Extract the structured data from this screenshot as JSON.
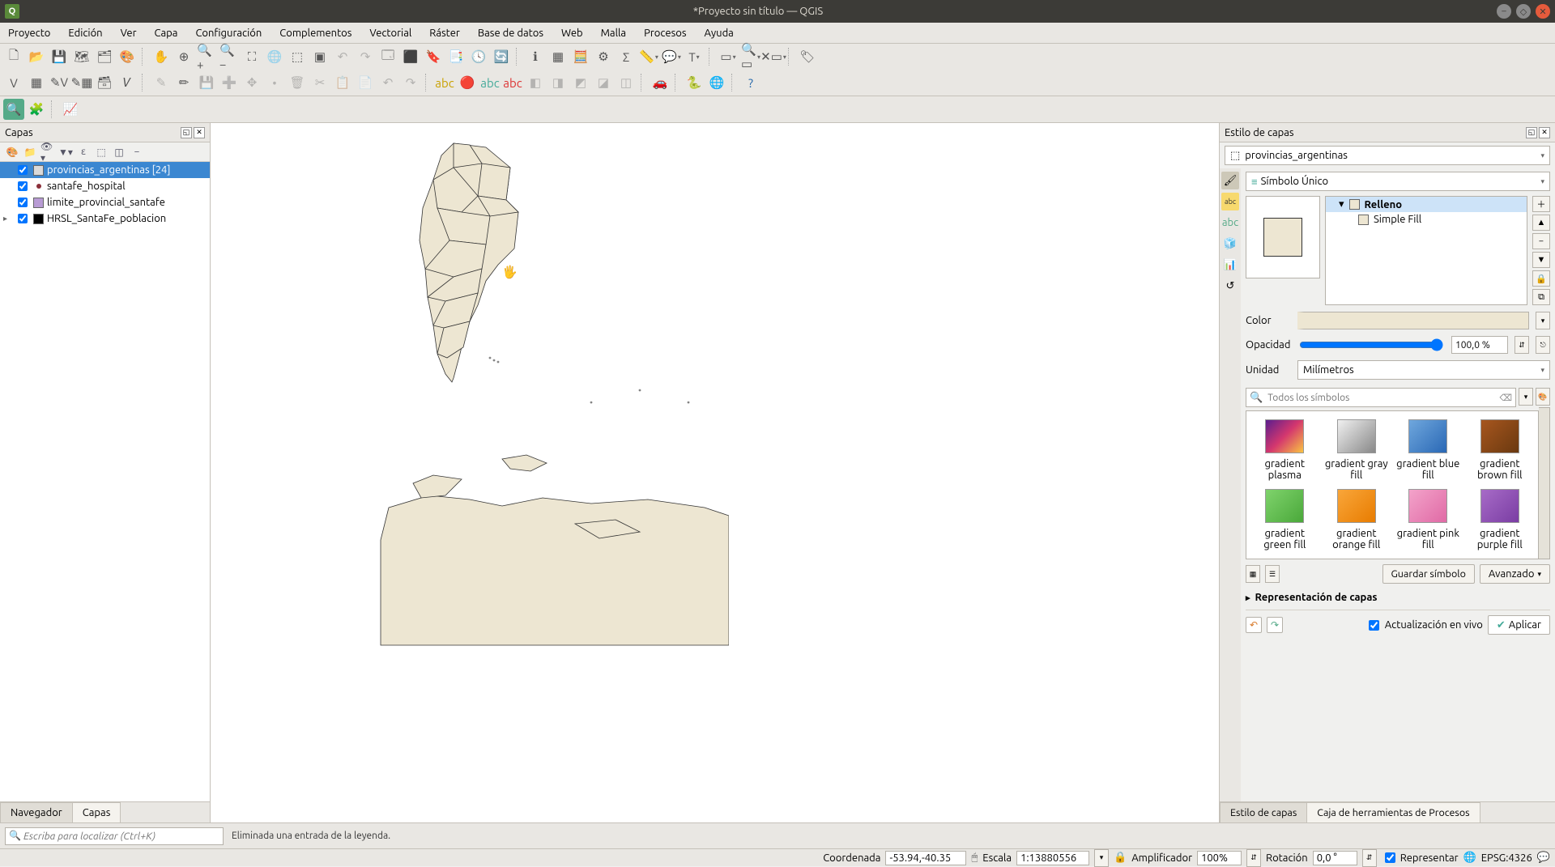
{
  "window": {
    "title": "*Proyecto sin título — QGIS"
  },
  "menubar": [
    "Proyecto",
    "Edición",
    "Ver",
    "Capa",
    "Configuración",
    "Complementos",
    "Vectorial",
    "Ráster",
    "Base de datos",
    "Web",
    "Malla",
    "Procesos",
    "Ayuda"
  ],
  "left_panel": {
    "title": "Capas",
    "layers": [
      {
        "name": "provincias_argentinas [24]",
        "checked": true,
        "selected": true,
        "swatch": "#d9d9d9"
      },
      {
        "name": "santafe_hospital",
        "checked": true,
        "selected": false,
        "swatch": "#8b2f3a",
        "dot": true
      },
      {
        "name": "limite_provincial_santafe",
        "checked": true,
        "selected": false,
        "swatch": "#b89bd4"
      },
      {
        "name": "HRSL_SantaFe_poblacion",
        "checked": true,
        "selected": false,
        "swatch": "#000",
        "expand": true
      }
    ],
    "tabs": {
      "navegador": "Navegador",
      "capas": "Capas"
    }
  },
  "right_panel": {
    "title": "Estilo de capas",
    "layer_combo": "provincias_argentinas",
    "symbol_type": "Símbolo Único",
    "tree": {
      "fill": "Relleno",
      "simple": "Simple Fill"
    },
    "props": {
      "color_label": "Color",
      "opacity_label": "Opacidad",
      "opacity_value": "100,0 %",
      "unit_label": "Unidad",
      "unit_value": "Milímetros"
    },
    "search_placeholder": "Todos los símbolos",
    "symbols": [
      {
        "name": "gradient plasma",
        "bg": "linear-gradient(135deg,#5b1e8e,#d4376e,#f9c441)"
      },
      {
        "name": "gradient gray fill",
        "bg": "linear-gradient(135deg,#f0f0f0,#888)"
      },
      {
        "name": "gradient blue fill",
        "bg": "linear-gradient(135deg,#6fa7dd,#2a68b5)"
      },
      {
        "name": "gradient brown fill",
        "bg": "linear-gradient(135deg,#a7561e,#6a3910)"
      },
      {
        "name": "gradient green fill",
        "bg": "linear-gradient(135deg,#7fd36c,#4aa83a)"
      },
      {
        "name": "gradient orange fill",
        "bg": "linear-gradient(135deg,#f9a63a,#e87c00)"
      },
      {
        "name": "gradient pink fill",
        "bg": "linear-gradient(135deg,#f3a3ca,#e06aa5)"
      },
      {
        "name": "gradient purple fill",
        "bg": "linear-gradient(135deg,#a76bc7,#7a3da3)"
      }
    ],
    "save_symbol": "Guardar símbolo",
    "advanced": "Avanzado",
    "repr_section": "Representación de capas",
    "live_update": "Actualización en vivo",
    "apply": "Aplicar",
    "tabs": {
      "style": "Estilo de capas",
      "toolbox": "Caja de herramientas de Procesos"
    }
  },
  "locator": {
    "placeholder": "Escriba para localizar (Ctrl+K)",
    "message": "Eliminada una entrada de la leyenda."
  },
  "statusbar": {
    "coord_label": "Coordenada",
    "coord_value": "-53.94,-40.35",
    "scale_label": "Escala",
    "scale_value": "1:13880556",
    "amp_label": "Amplificador",
    "amp_value": "100%",
    "rot_label": "Rotación",
    "rot_value": "0,0 °",
    "render_label": "Representar",
    "crs": "EPSG:4326"
  }
}
